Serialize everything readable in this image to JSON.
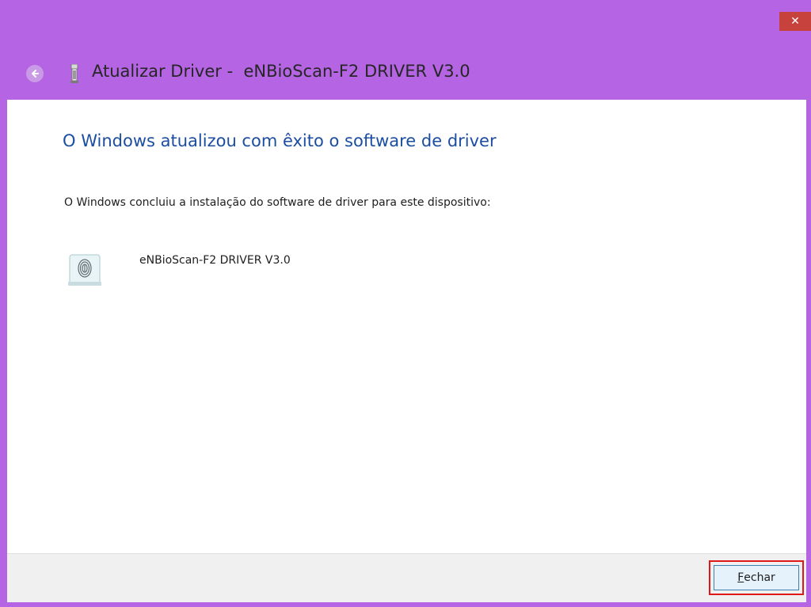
{
  "window": {
    "title": "Atualizar Driver -  eNBioScan-F2 DRIVER V3.0",
    "close_glyph": "✕",
    "accent_color": "#b565e3"
  },
  "main": {
    "heading": "O Windows atualizou com êxito o software de driver",
    "description": "O Windows concluiu a instalação do software de driver para este dispositivo:",
    "device_name": "eNBioScan-F2 DRIVER V3.0",
    "device_icon": "fingerprint-icon"
  },
  "footer": {
    "close_button": {
      "mnemonic": "F",
      "rest": "echar"
    }
  }
}
